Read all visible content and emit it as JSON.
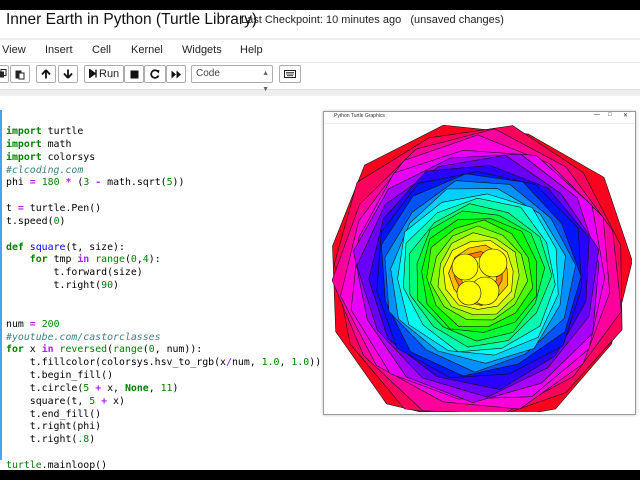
{
  "notebook": {
    "title": "Inner Earth in Python (Turtle Library)",
    "checkpoint": "Last Checkpoint: 10 minutes ago",
    "save_status": "(unsaved changes)"
  },
  "menu": {
    "items": [
      "View",
      "Insert",
      "Cell",
      "Kernel",
      "Widgets",
      "Help"
    ]
  },
  "toolbar": {
    "run_label": "Run",
    "cell_type": "Code",
    "icons": [
      "copy-icon",
      "paste-icon",
      "move-up-icon",
      "move-down-icon",
      "run-icon",
      "stop-icon",
      "restart-icon",
      "fast-forward-icon",
      "keyboard-icon"
    ]
  },
  "turtle_window": {
    "title": "Python Turtle Graphics",
    "drawing": {
      "num_squares": 200,
      "color_map": "hsv hue = x/num",
      "colors": [
        "#ff0000",
        "#ff00ff",
        "#0000ff",
        "#00ffff",
        "#00ff00",
        "#ffff00"
      ]
    }
  },
  "code": {
    "lines": [
      "import turtle",
      "import math",
      "import colorsys",
      "#clcoding.com",
      "phi = 180 * (3 - math.sqrt(5))",
      "",
      "t = turtle.Pen()",
      "t.speed(0)",
      "",
      "def square(t, size):",
      "    for tmp in range(0,4):",
      "        t.forward(size)",
      "        t.right(90)",
      "",
      "",
      "num = 200",
      "#youtube.com/castorclasses",
      "for x in reversed(range(0, num)):",
      "    t.fillcolor(colorsys.hsv_to_rgb(x/num, 1.0, 1.0))",
      "    t.begin_fill()",
      "    t.circle(5 + x, None, 11)",
      "    square(t, 5 + x)",
      "    t.end_fill()",
      "    t.right(phi)",
      "    t.right(.8)",
      "",
      "turtle.mainloop()"
    ]
  }
}
